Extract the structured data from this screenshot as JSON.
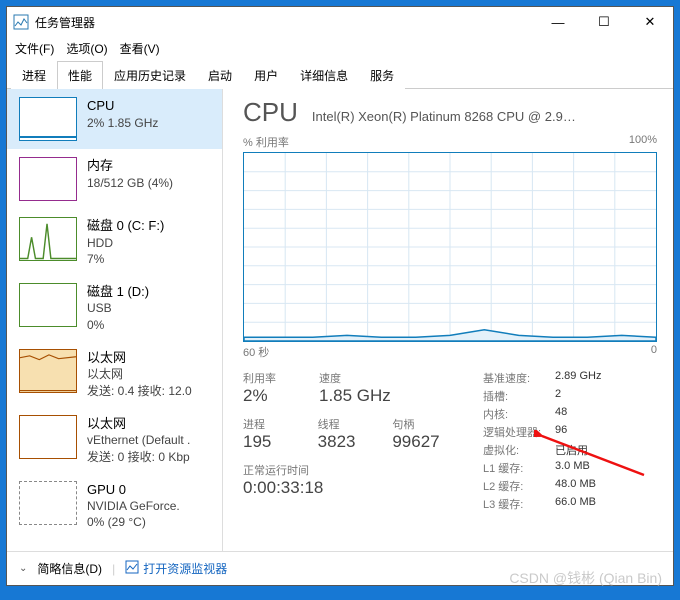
{
  "window": {
    "title": "任务管理器",
    "min": "—",
    "max": "☐",
    "close": "✕"
  },
  "menus": [
    "文件(F)",
    "选项(O)",
    "查看(V)"
  ],
  "tabs": [
    "进程",
    "性能",
    "应用历史记录",
    "启动",
    "用户",
    "详细信息",
    "服务"
  ],
  "activeTab": 1,
  "sidebar": [
    {
      "title": "CPU",
      "sub": "2% 1.85 GHz"
    },
    {
      "title": "内存",
      "sub": "18/512 GB (4%)"
    },
    {
      "title": "磁盘 0 (C: F:)",
      "sub": "HDD",
      "sub2": "7%"
    },
    {
      "title": "磁盘 1 (D:)",
      "sub": "USB",
      "sub2": "0%"
    },
    {
      "title": "以太网",
      "sub": "以太网",
      "sub2": "发送: 0.4 接收: 12.0"
    },
    {
      "title": "以太网",
      "sub": "vEthernet (Default .",
      "sub2": "发送: 0 接收: 0 Kbp"
    },
    {
      "title": "GPU 0",
      "sub": "NVIDIA GeForce.",
      "sub2": "0% (29 °C)"
    }
  ],
  "cpu": {
    "heading": "CPU",
    "model": "Intel(R) Xeon(R) Platinum 8268 CPU @ 2.9…",
    "graphTitle": "% 利用率",
    "graphMax": "100%",
    "xLeft": "60 秒",
    "xRight": "0"
  },
  "statcols1": {
    "labels": [
      "利用率",
      "速度"
    ],
    "values": [
      "2%",
      "1.85 GHz"
    ]
  },
  "statcols2": {
    "labels": [
      "进程",
      "线程",
      "句柄"
    ],
    "values": [
      "195",
      "3823",
      "99627"
    ]
  },
  "uptime": {
    "label": "正常运行时间",
    "value": "0:00:33:18"
  },
  "right": [
    {
      "k": "基准速度:",
      "v": "2.89 GHz"
    },
    {
      "k": "插槽:",
      "v": "2"
    },
    {
      "k": "内核:",
      "v": "48"
    },
    {
      "k": "逻辑处理器:",
      "v": "96"
    },
    {
      "k": "虚拟化:",
      "v": "已启用"
    },
    {
      "k": "L1 缓存:",
      "v": "3.0 MB"
    },
    {
      "k": "L2 缓存:",
      "v": "48.0 MB"
    },
    {
      "k": "L3 缓存:",
      "v": "66.0 MB"
    }
  ],
  "footer": {
    "brief": "简略信息(D)",
    "link": "打开资源监视器"
  },
  "watermark": "CSDN @钱彬 (Qian Bin)",
  "chart_data": {
    "type": "line",
    "title": "% 利用率",
    "xlabel": "60 秒 → 0",
    "ylabel": "%",
    "ylim": [
      0,
      100
    ],
    "x": [
      60,
      55,
      50,
      45,
      40,
      35,
      30,
      25,
      20,
      15,
      10,
      5,
      0
    ],
    "values": [
      2,
      2,
      2,
      3,
      2,
      2,
      3,
      6,
      3,
      2,
      2,
      3,
      2
    ]
  }
}
